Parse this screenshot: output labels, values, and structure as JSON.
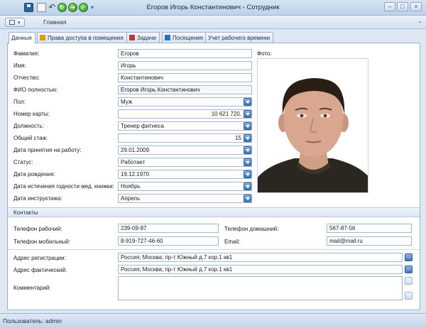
{
  "window": {
    "title": "Егоров Игорь Константинович - Сотрудник",
    "minimize_glyph": "–",
    "maximize_glyph": "□",
    "close_glyph": "×"
  },
  "ribbon": {
    "tab_label": "Главная"
  },
  "tabs": [
    {
      "label": "Данные",
      "icon": "none",
      "color": "#ffffff"
    },
    {
      "label": "Права доступа в помещения",
      "icon": "key-icon",
      "color": "#d4a017"
    },
    {
      "label": "Задачи",
      "icon": "tasks-icon",
      "color": "#c0392b"
    },
    {
      "label": "Посещения",
      "icon": "visits-icon",
      "color": "#2e6fb5"
    },
    {
      "label": "Учет рабочего времени",
      "icon": "none",
      "color": "#ffffff"
    }
  ],
  "form": {
    "last_name": {
      "label": "Фамилия:",
      "value": "Егоров"
    },
    "first_name": {
      "label": "Имя:",
      "value": "Игорь"
    },
    "patronymic": {
      "label": "Отчество:",
      "value": "Константинович"
    },
    "full_name": {
      "label": "ФИО полностью:",
      "value": "Егоров Игорь Константинович"
    },
    "gender": {
      "label": "Пол:",
      "value": "Муж"
    },
    "card_number": {
      "label": "Номер карты:",
      "value": "10 621 720."
    },
    "position": {
      "label": "Должность:",
      "value": "Тренер фитнеса"
    },
    "experience": {
      "label": "Общий стаж:",
      "value": "15"
    },
    "hire_date": {
      "label": "Дата принятия на работу:",
      "value": "29.01.2009"
    },
    "status": {
      "label": "Статус:",
      "value": "Работает"
    },
    "birth_date": {
      "label": "Дата рождения:",
      "value": "19.12.1970"
    },
    "med_book_expiry": {
      "label": "Дата истечения годности мед. книжки:",
      "value": "Ноябрь"
    },
    "briefing_date": {
      "label": "Дата инструктажа:",
      "value": "Апрель"
    },
    "photo_label": "Фото:"
  },
  "contacts": {
    "section_title": "Контакты",
    "work_phone": {
      "label": "Телефон рабочий:",
      "value": "239-09-87"
    },
    "home_phone": {
      "label": "Телефон домашний:",
      "value": "567-87-56"
    },
    "mobile_phone": {
      "label": "Телефон мобильный:",
      "value": "8-919-727-46-60"
    },
    "email": {
      "label": "Email:",
      "value": "mail@mail.ru"
    }
  },
  "address": {
    "registration": {
      "label": "Адрес регистрации:",
      "value": "Россия; Москва; пр-т Южный д.7 кор.1 кв1"
    },
    "actual": {
      "label": "Адрес фактический:",
      "value": "Россия; Москва; пр-т Южный д.7 кор.1 кв1"
    },
    "comment": {
      "label": "Комментарий:",
      "value": ""
    },
    "ellipsis_glyph": "..."
  },
  "status_bar": {
    "text": "Пользователь: admin"
  }
}
